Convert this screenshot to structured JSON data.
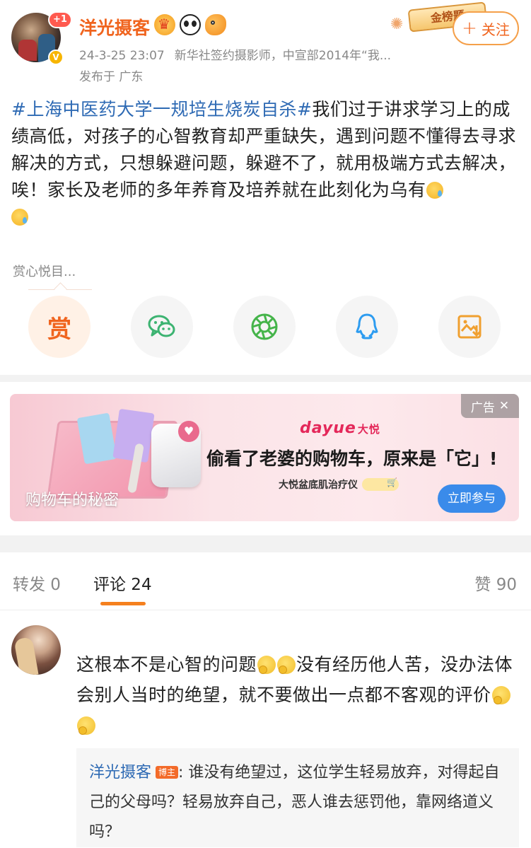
{
  "post": {
    "author": "洋光摄客",
    "notification_count": "+1",
    "verified_mark": "V",
    "name_icons": [
      "crown-icon",
      "panda-icon",
      "fish-icon"
    ],
    "date": "24-3-25 23:07",
    "bio": "新华社签约摄影师，中宣部2014年“我...",
    "location": "发布于 广东",
    "top_badge": "金榜题",
    "follow_label": "关注",
    "hashtag": "#上海中医药大学一规培生烧炭自杀#",
    "body": "我们过于讲求学习上的成绩高低，对孩子的心智教育却严重缺失，遇到问题不懂得去寻求解决的方式，只想躲避问题，躲避不了，就用极端方式去解决，唉！家长及老师的多年养育及培养就在此刻化为乌有"
  },
  "reward": {
    "label": "赏心悦目...",
    "button": "赏"
  },
  "share_icons": [
    "reward-icon",
    "wechat-icon",
    "moments-icon",
    "qq-icon",
    "save-image-icon"
  ],
  "ad": {
    "caption": "购物车的秘密",
    "brand": "dayue",
    "brand_cn": "大悦",
    "headline": "偷看了老婆的购物车，原来是「它」!",
    "product": "大悦盆底肌治疗仪",
    "tag": "广告",
    "cta": "立即参与"
  },
  "tabs": {
    "repost": "转发 0",
    "comments": "评论 24",
    "likes": "赞 90"
  },
  "comment": {
    "text_part1": "这根本不是心智的问题",
    "text_part2": "没有经历他人苦，没办法体会别人当时的绝望，就不要做出一点都不客观的评价",
    "reply": {
      "name": "洋光摄客",
      "badge": "博主",
      "text": ": 谁没有绝望过，这位学生轻易放弃，对得起自己的父母吗？轻易放弃自己，恶人谁去惩罚他，靠网络道义吗？"
    }
  },
  "colors": {
    "accent": "#f0641e",
    "link": "#2e6ab4",
    "cta": "#3a8bea"
  }
}
